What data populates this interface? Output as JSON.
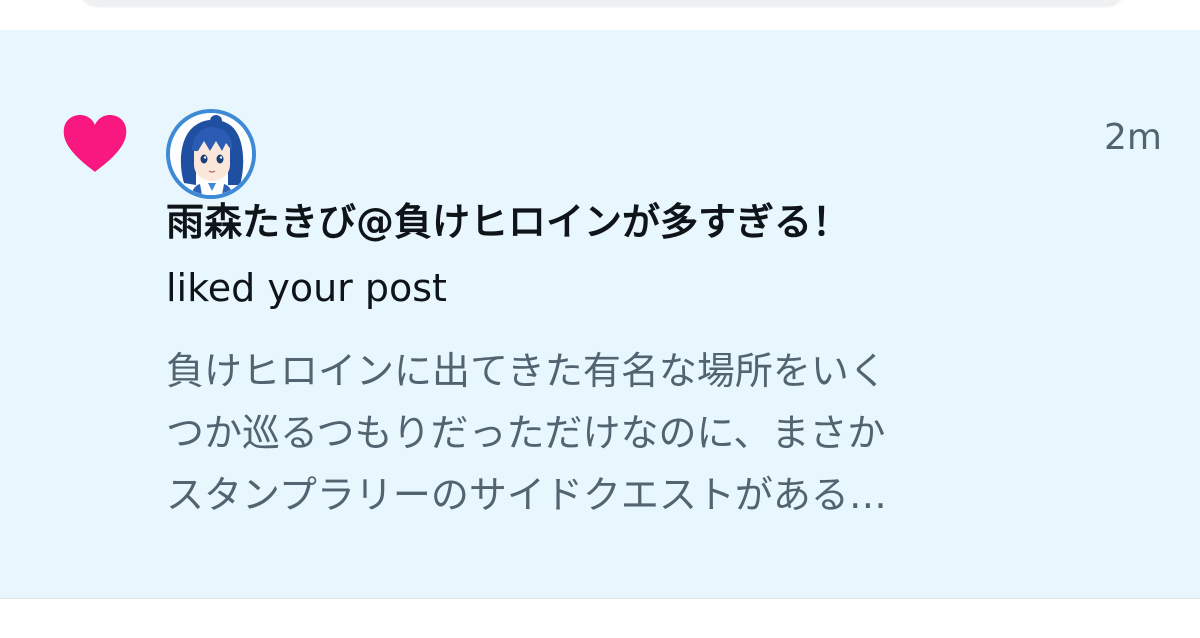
{
  "notification": {
    "type": "like",
    "icon": "heart-icon",
    "avatar_icon": "user-avatar-anime-girl",
    "timestamp": "2m",
    "user_name": "雨森たきび@負けヒロインが多すぎる！",
    "action_text": "liked your post",
    "post_excerpt_lines": [
      "負けヒロインに出てきた有名な場所をいく",
      "つか巡るつもりだっただけなのに、まさか",
      "スタンプラリーのサイドクエストがある…"
    ]
  },
  "colors": {
    "background": "#e8f6fe",
    "heart": "#f91880",
    "name_text": "#0f1419",
    "secondary_text": "#536471",
    "avatar_border": "#3e8ad6"
  }
}
